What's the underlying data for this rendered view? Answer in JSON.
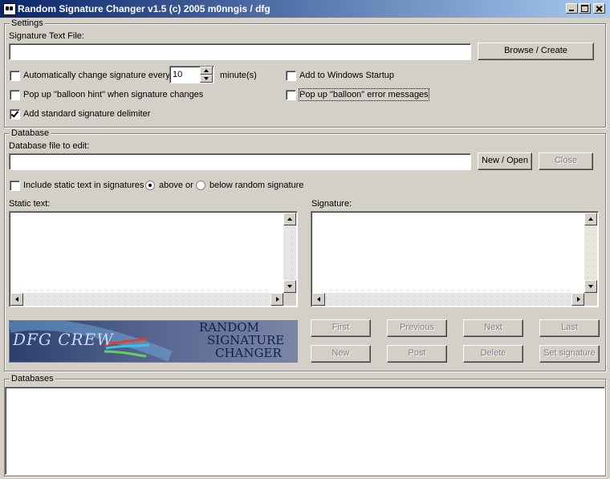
{
  "window": {
    "title": "Random Signature Changer v1.5 (c) 2005 m0nngis / dfg"
  },
  "settings": {
    "legend": "Settings",
    "sig_file_label": "Signature Text File:",
    "sig_file_value": "",
    "browse_label": "Browse / Create",
    "auto_change_label": "Automatically change signature every",
    "auto_change_checked": false,
    "interval_value": "10",
    "interval_unit": "minute(s)",
    "startup_label": "Add to Windows Startup",
    "startup_checked": false,
    "balloon_hint_label": "Pop up \"balloon hint\" when signature changes",
    "balloon_hint_checked": false,
    "balloon_error_label": "Pop up \"balloon\" error messages",
    "balloon_error_checked": false,
    "delimiter_label": "Add standard signature delimiter",
    "delimiter_checked": true
  },
  "database": {
    "legend": "Database",
    "file_label": "Database file to edit:",
    "file_value": "",
    "new_open_label": "New / Open",
    "close_label": "Close",
    "include_static_label": "Include static text in signatures",
    "include_static_checked": false,
    "above_label": "above or",
    "below_label": "below random signature",
    "position_selected": "above",
    "static_text_label": "Static text:",
    "signature_label": "Signature:",
    "nav": {
      "first": "First",
      "previous": "Previous",
      "next": "Next",
      "last": "Last"
    },
    "actions": {
      "new": "New",
      "post": "Post",
      "delete": "Delete",
      "set_signature": "Set signature"
    }
  },
  "banner": {
    "left_text": "DFG CREW",
    "line1": "RANDOM",
    "line2": "SIGNATURE",
    "line3": "CHANGER"
  },
  "databases": {
    "legend": "Databases"
  },
  "icons": {
    "app": "app-icon",
    "minimize": "minimize-icon",
    "maximize": "maximize-icon",
    "close": "close-icon"
  }
}
